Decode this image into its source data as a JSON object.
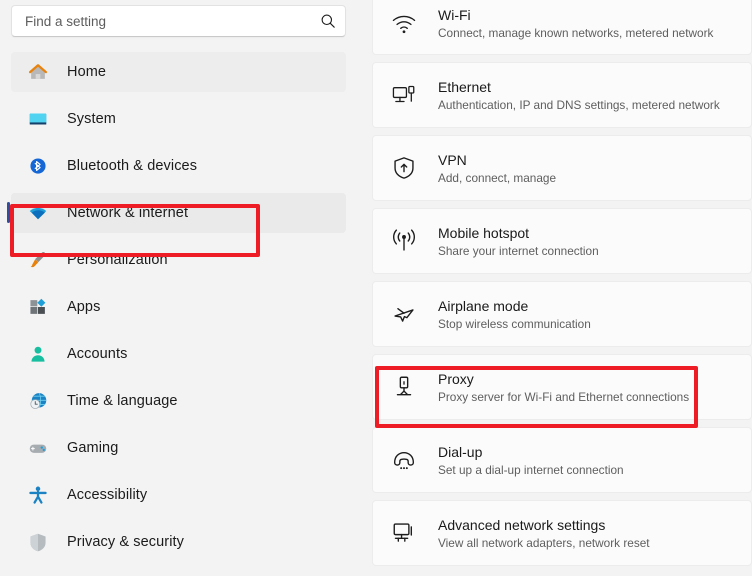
{
  "search": {
    "placeholder": "Find a setting",
    "value": "",
    "icon": "search-icon"
  },
  "sidebar": {
    "items": [
      {
        "label": "Home",
        "icon": "home-icon",
        "state": "hover"
      },
      {
        "label": "System",
        "icon": "system-icon",
        "state": "normal"
      },
      {
        "label": "Bluetooth & devices",
        "icon": "bluetooth-icon",
        "state": "normal"
      },
      {
        "label": "Network & internet",
        "icon": "network-wifi-icon",
        "state": "selected"
      },
      {
        "label": "Personalization",
        "icon": "paintbrush-icon",
        "state": "normal"
      },
      {
        "label": "Apps",
        "icon": "apps-icon",
        "state": "normal"
      },
      {
        "label": "Accounts",
        "icon": "account-person-icon",
        "state": "normal"
      },
      {
        "label": "Time & language",
        "icon": "clock-globe-icon",
        "state": "normal"
      },
      {
        "label": "Gaming",
        "icon": "gamepad-icon",
        "state": "normal"
      },
      {
        "label": "Accessibility",
        "icon": "accessibility-icon",
        "state": "normal"
      },
      {
        "label": "Privacy & security",
        "icon": "shield-icon",
        "state": "normal"
      }
    ]
  },
  "main": {
    "cards": [
      {
        "title": "Wi-Fi",
        "subtitle": "Connect, manage known networks, metered network",
        "icon": "wifi-icon"
      },
      {
        "title": "Ethernet",
        "subtitle": "Authentication, IP and DNS settings, metered network",
        "icon": "ethernet-icon"
      },
      {
        "title": "VPN",
        "subtitle": "Add, connect, manage",
        "icon": "vpn-shield-icon"
      },
      {
        "title": "Mobile hotspot",
        "subtitle": "Share your internet connection",
        "icon": "hotspot-antenna-icon"
      },
      {
        "title": "Airplane mode",
        "subtitle": "Stop wireless communication",
        "icon": "airplane-icon"
      },
      {
        "title": "Proxy",
        "subtitle": "Proxy server for Wi-Fi and Ethernet connections",
        "icon": "proxy-server-icon"
      },
      {
        "title": "Dial-up",
        "subtitle": "Set up a dial-up internet connection",
        "icon": "dialup-phone-icon"
      },
      {
        "title": "Advanced network settings",
        "subtitle": "View all network adapters, network reset",
        "icon": "advanced-network-icon"
      }
    ]
  },
  "annotations": {
    "color": "#ee1c25",
    "boxes": [
      {
        "name": "sidebar-network-highlight",
        "target": "Network & internet"
      },
      {
        "name": "proxy-card-highlight",
        "target": "Proxy"
      }
    ]
  },
  "colors": {
    "accent": "#2f4e9e",
    "annotation": "#ee1c25",
    "page_bg": "#f3f3f3",
    "card_bg": "#fbfbfb"
  }
}
